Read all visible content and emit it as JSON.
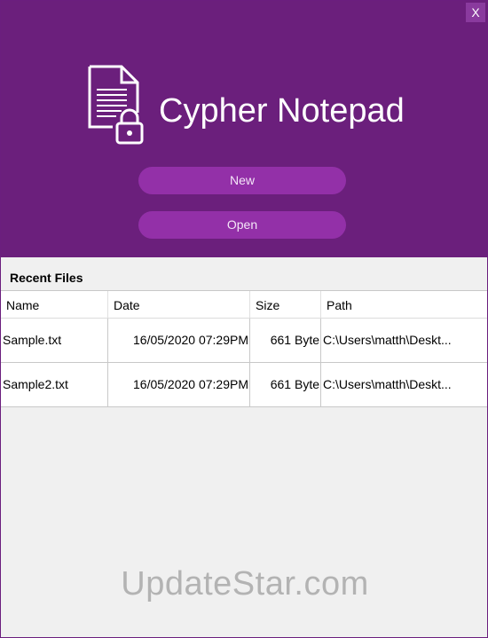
{
  "window": {
    "close_label": "X"
  },
  "header": {
    "logo_icon": "document-lock-icon",
    "app_title": "Cypher Notepad",
    "new_label": "New",
    "open_label": "Open",
    "colors": {
      "background": "#6b1f7c",
      "button": "#9330a8"
    }
  },
  "recent": {
    "title": "Recent Files",
    "columns": {
      "name": "Name",
      "date": "Date",
      "size": "Size",
      "path": "Path"
    },
    "rows": [
      {
        "name": "Sample.txt",
        "date": "16/05/2020 07:29PM",
        "size": "661 Byte",
        "path": "C:\\Users\\matth\\Deskt..."
      },
      {
        "name": "Sample2.txt",
        "date": "16/05/2020 07:29PM",
        "size": "661 Byte",
        "path": "C:\\Users\\matth\\Deskt..."
      }
    ]
  },
  "watermark": "UpdateStar.com"
}
